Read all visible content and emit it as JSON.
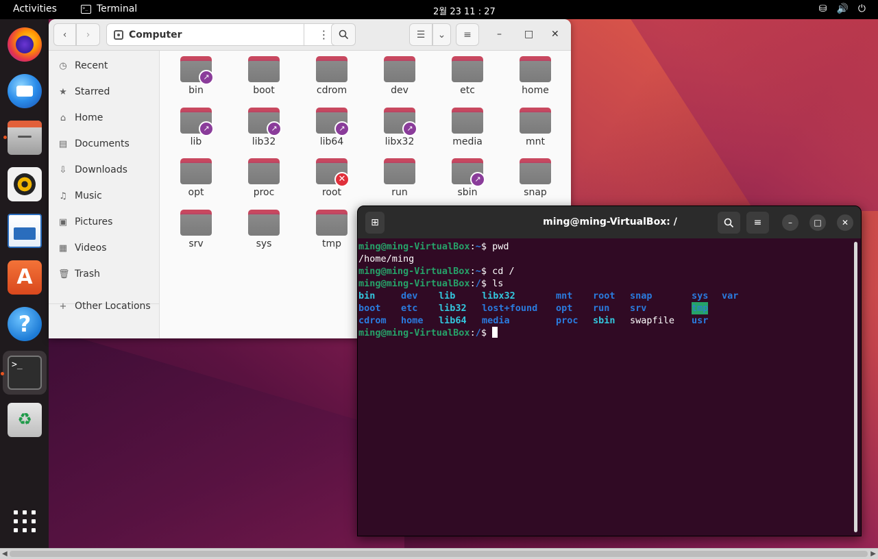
{
  "topbar": {
    "activities": "Activities",
    "app_name": "Terminal",
    "clock": "2월 23  11 : 27",
    "tray_icons": [
      "network-icon",
      "volume-icon",
      "power-icon"
    ]
  },
  "dock": {
    "items": [
      "firefox-icon",
      "thunderbird-icon",
      "files-icon",
      "rhythmbox-icon",
      "writer-icon",
      "app-center-icon",
      "help-icon",
      "terminal-icon",
      "trash-icon",
      "show-apps-icon"
    ],
    "terminal_glyph": ">_",
    "trash_glyph": "♻"
  },
  "files": {
    "location": "Computer",
    "sidebar": [
      {
        "label": "Recent",
        "icon": "◷"
      },
      {
        "label": "Starred",
        "icon": "★"
      },
      {
        "label": "Home",
        "icon": "⌂"
      },
      {
        "label": "Documents",
        "icon": "▤"
      },
      {
        "label": "Downloads",
        "icon": "⇩"
      },
      {
        "label": "Music",
        "icon": "♫"
      },
      {
        "label": "Pictures",
        "icon": "▣"
      },
      {
        "label": "Videos",
        "icon": "▦"
      },
      {
        "label": "Trash",
        "icon": "🗑"
      }
    ],
    "other_locations": "Other Locations",
    "folders": [
      {
        "name": "bin",
        "badge": "link"
      },
      {
        "name": "boot",
        "badge": ""
      },
      {
        "name": "cdrom",
        "badge": ""
      },
      {
        "name": "dev",
        "badge": ""
      },
      {
        "name": "etc",
        "badge": ""
      },
      {
        "name": "home",
        "badge": ""
      },
      {
        "name": "lib",
        "badge": "link"
      },
      {
        "name": "lib32",
        "badge": "link"
      },
      {
        "name": "lib64",
        "badge": "link"
      },
      {
        "name": "libx32",
        "badge": "link"
      },
      {
        "name": "media",
        "badge": ""
      },
      {
        "name": "mnt",
        "badge": ""
      },
      {
        "name": "opt",
        "badge": ""
      },
      {
        "name": "proc",
        "badge": ""
      },
      {
        "name": "root",
        "badge": "locked"
      },
      {
        "name": "run",
        "badge": ""
      },
      {
        "name": "sbin",
        "badge": "link"
      },
      {
        "name": "snap",
        "badge": ""
      },
      {
        "name": "srv",
        "badge": ""
      },
      {
        "name": "sys",
        "badge": ""
      },
      {
        "name": "tmp",
        "badge": ""
      }
    ]
  },
  "terminal": {
    "title": "ming@ming-VirtualBox: /",
    "prompt_user": "ming@ming-VirtualBox",
    "lines": [
      {
        "path": "~",
        "cmd": "pwd"
      },
      {
        "output": "/home/ming"
      },
      {
        "path": "~",
        "cmd": "cd /"
      },
      {
        "path": "/",
        "cmd": "ls"
      }
    ],
    "final_path": "/",
    "ls_columns": [
      [
        {
          "t": "bin",
          "c": "link"
        },
        {
          "t": "boot",
          "c": "dir"
        },
        {
          "t": "cdrom",
          "c": "dir"
        }
      ],
      [
        {
          "t": "dev",
          "c": "dir"
        },
        {
          "t": "etc",
          "c": "dir"
        },
        {
          "t": "home",
          "c": "dir"
        }
      ],
      [
        {
          "t": "lib",
          "c": "link"
        },
        {
          "t": "lib32",
          "c": "link"
        },
        {
          "t": "lib64",
          "c": "link"
        }
      ],
      [
        {
          "t": "libx32",
          "c": "link"
        },
        {
          "t": "lost+found",
          "c": "dir"
        },
        {
          "t": "media",
          "c": "dir"
        }
      ],
      [
        {
          "t": "mnt",
          "c": "dir"
        },
        {
          "t": "opt",
          "c": "dir"
        },
        {
          "t": "proc",
          "c": "dir"
        }
      ],
      [
        {
          "t": "root",
          "c": "dir"
        },
        {
          "t": "run",
          "c": "dir"
        },
        {
          "t": "sbin",
          "c": "link"
        }
      ],
      [
        {
          "t": "snap",
          "c": "dir"
        },
        {
          "t": "srv",
          "c": "dir"
        },
        {
          "t": "swapfile",
          "c": "file"
        }
      ],
      [
        {
          "t": "sys",
          "c": "dir"
        },
        {
          "t": "tmp",
          "c": "hl"
        },
        {
          "t": "usr",
          "c": "dir"
        }
      ],
      [
        {
          "t": "var",
          "c": "dir"
        }
      ]
    ]
  }
}
